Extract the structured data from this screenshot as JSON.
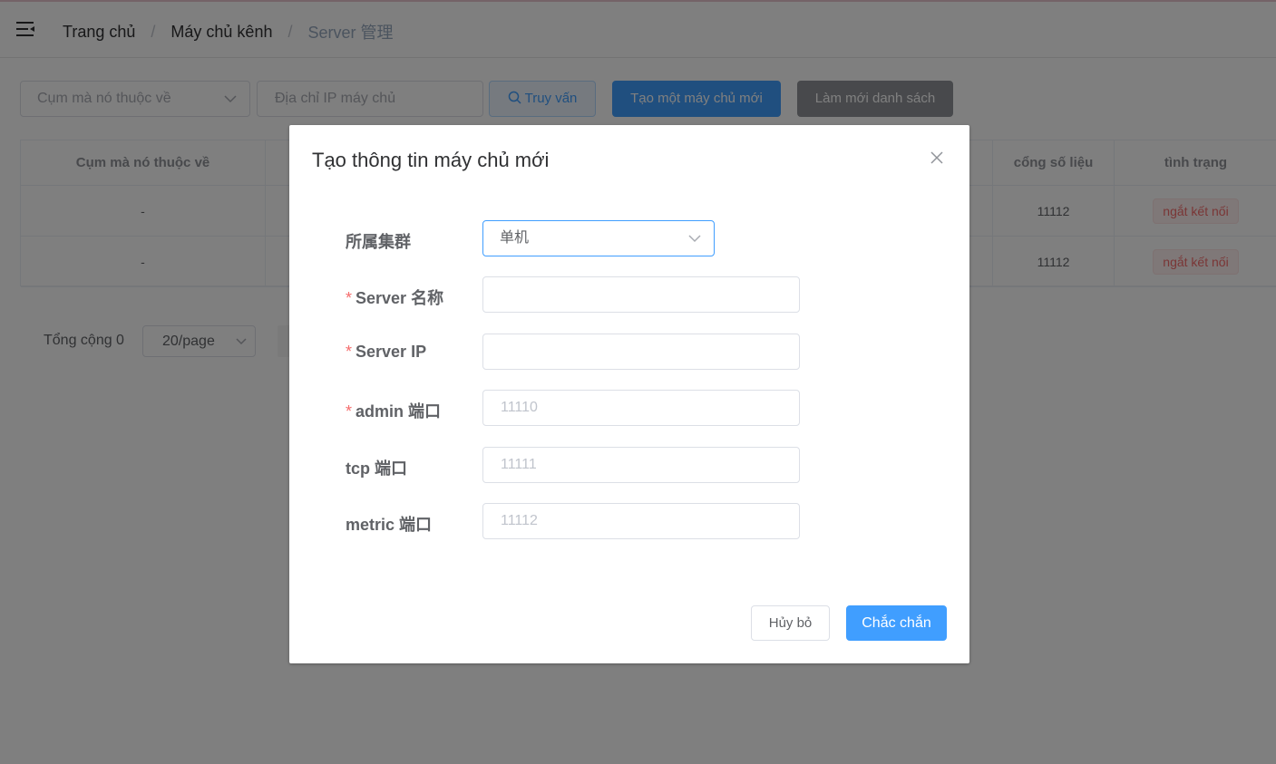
{
  "header": {
    "menu_icon": "hamburger-menu-icon",
    "breadcrumb": [
      "Trang chủ",
      "Máy chủ kênh",
      "Server 管理"
    ],
    "separator": "/"
  },
  "filters": {
    "cluster_placeholder": "Cụm mà nó thuộc về",
    "ip_placeholder": "Địa chỉ IP máy chủ",
    "query_label": "Truy vấn",
    "create_label": "Tạo một máy chủ mới",
    "refresh_label": "Làm mới danh sách"
  },
  "table": {
    "columns": [
      "Cụm mà nó thuộc về",
      "cổng số liệu",
      "tình trạng"
    ],
    "rows": [
      {
        "cluster": "-",
        "metric_port": "11112",
        "status": "ngắt kết nối"
      },
      {
        "cluster": "-",
        "metric_port": "11112",
        "status": "ngắt kết nối"
      }
    ]
  },
  "pagination": {
    "total": "Tổng cộng 0",
    "page_size": "20/page"
  },
  "dialog": {
    "title": "Tạo thông tin máy chủ mới",
    "fields": {
      "cluster": {
        "label": "所属集群",
        "value": "单机"
      },
      "name": {
        "label": "Server 名称",
        "required": "*",
        "placeholder": ""
      },
      "ip": {
        "label": "Server IP",
        "required": "*",
        "placeholder": ""
      },
      "admin_port": {
        "label": "admin 端口",
        "required": "*",
        "placeholder": "11110"
      },
      "tcp_port": {
        "label": "tcp 端口",
        "placeholder": "11111"
      },
      "metric_port": {
        "label": "metric 端口",
        "placeholder": "11112"
      }
    },
    "cancel_label": "Hủy bỏ",
    "ok_label": "Chắc chắn"
  },
  "colors": {
    "primary": "#409eff",
    "danger": "#f56c6c",
    "info": "#909399"
  }
}
